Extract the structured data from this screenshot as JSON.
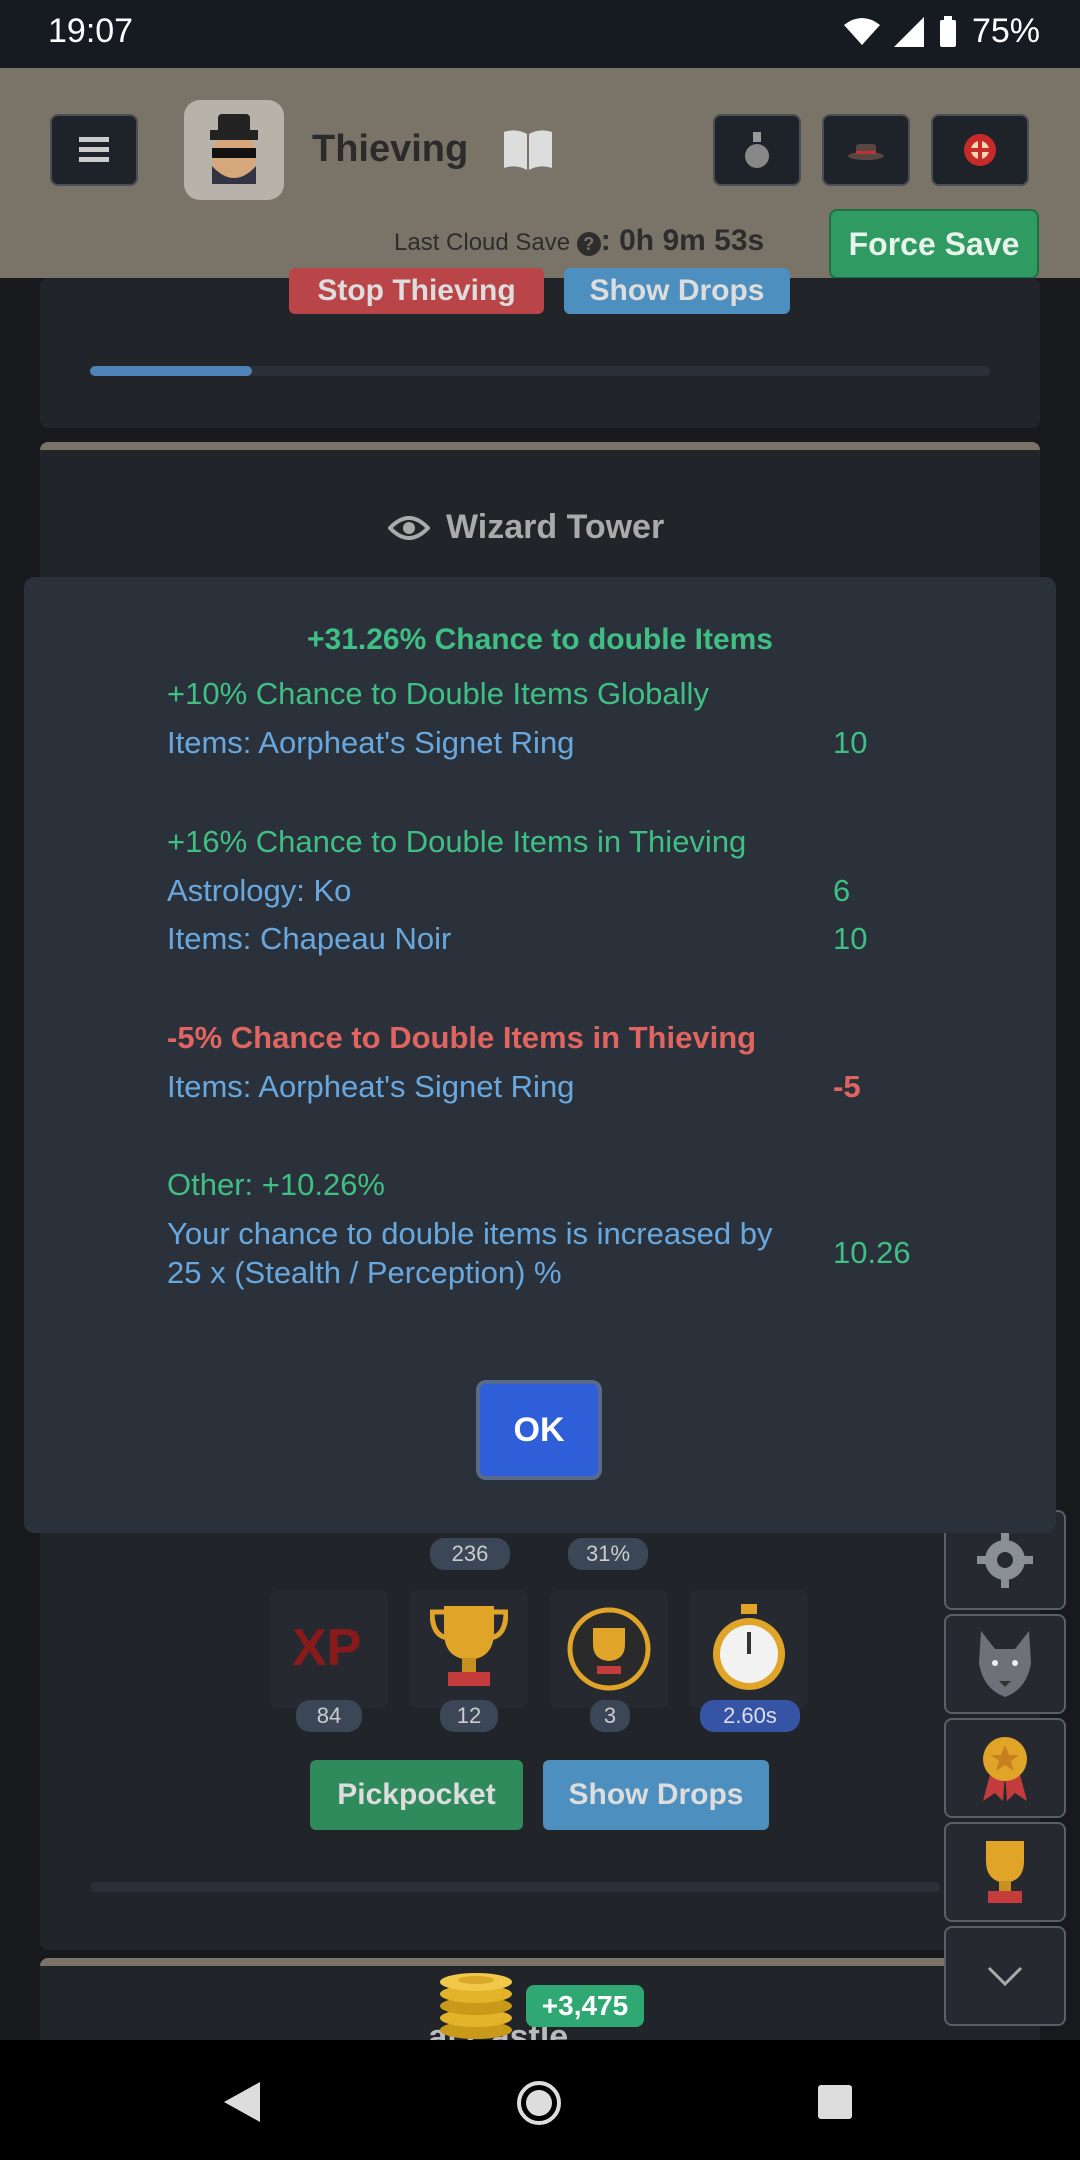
{
  "status_bar": {
    "time": "19:07",
    "battery": "75%"
  },
  "header": {
    "title": "Thieving",
    "cloud_label": "Last Cloud Save",
    "cloud_time": ": 0h 9m 53s",
    "force_save": "Force Save"
  },
  "background": {
    "stop_button": "Stop Thieving",
    "show_drops_top": "Show Drops",
    "progress_top": 0.18,
    "area_title": "Wizard Tower",
    "pill_a": "236",
    "pill_b": "31%",
    "stats": [
      {
        "icon": "xp-icon",
        "label": "XP",
        "value": "84"
      },
      {
        "icon": "trophy-icon",
        "value": "12"
      },
      {
        "icon": "mastery-trophy-icon",
        "value": "3"
      },
      {
        "icon": "stopwatch-icon",
        "value": "2.60s"
      }
    ],
    "pickpocket": "Pickpocket",
    "show_drops_bottom": "Show Drops",
    "gold_gain": "+3,475",
    "next_area_partial": "...al Castle"
  },
  "modal": {
    "heading": "+31.26% Chance to double Items",
    "groups": [
      {
        "title": "+10% Chance to Double Items Globally",
        "type": "positive",
        "rows": [
          {
            "source": "Items: Aorpheat's Signet Ring",
            "value": "10"
          }
        ]
      },
      {
        "title": "+16% Chance to Double Items in Thieving",
        "type": "positive",
        "rows": [
          {
            "source": "Astrology: Ko",
            "value": "6"
          },
          {
            "source": "Items: Chapeau Noir",
            "value": "10"
          }
        ]
      },
      {
        "title": "-5% Chance to Double Items in Thieving",
        "type": "negative",
        "rows": [
          {
            "source": "Items: Aorpheat's Signet Ring",
            "value": "-5"
          }
        ]
      },
      {
        "title": "Other: +10.26%",
        "type": "positive",
        "rows": [
          {
            "source_line1": "Your chance to double items is increased by",
            "source_line2": "25 x (Stealth / Perception) %",
            "value": "10.26"
          }
        ]
      }
    ],
    "ok_label": "OK"
  }
}
